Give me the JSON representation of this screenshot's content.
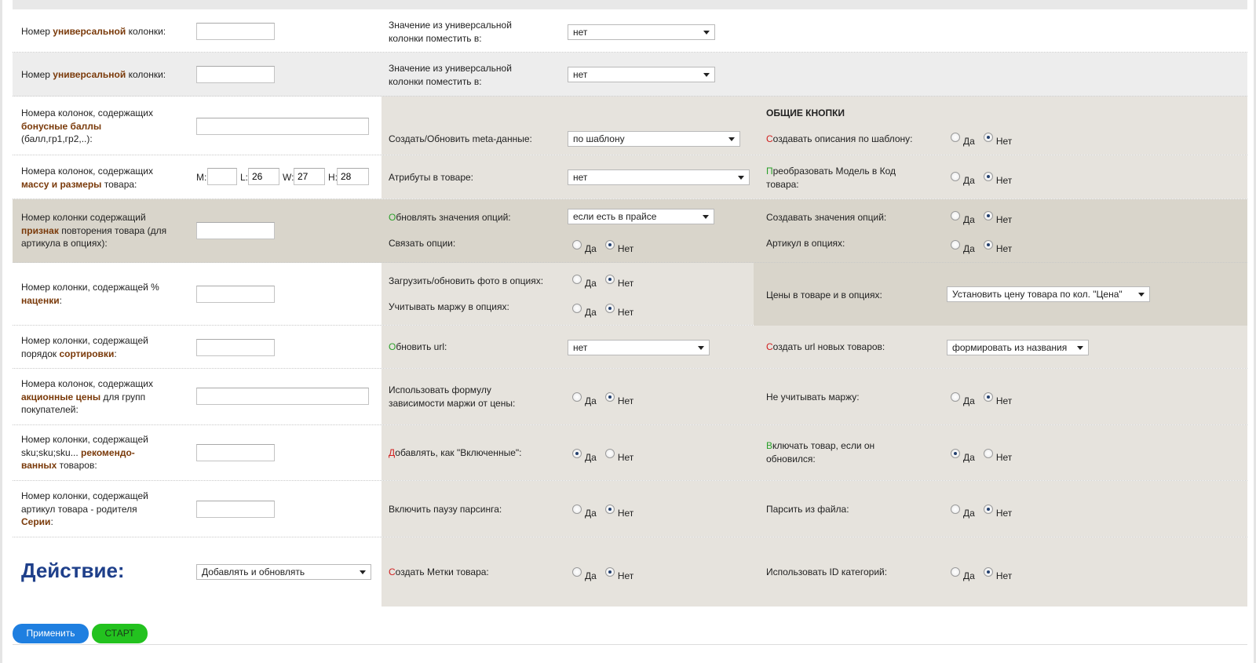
{
  "colors": {
    "brown_keyword": "#7a3a0a",
    "green_letter": "#2aa02a",
    "red_letter": "#d02020",
    "action_title": "#1e3f8a",
    "apply_button": "#1f7fe0",
    "start_button": "#23c21f"
  },
  "row1": {
    "label_pre": "Номер ",
    "label_kw": "универсальной",
    "label_post": " колонки:",
    "mid_label": "Значение из универсальной колонки поместить в:",
    "select_value": "нет"
  },
  "row2": {
    "label_pre": "Номер ",
    "label_kw": "универсальной",
    "label_post": " колонки:",
    "mid_label": "Значение из универсальной колонки поместить в:",
    "select_value": "нет"
  },
  "row3": {
    "label_pre": "Номера колонок, содержащих",
    "label_kw": "бонусные баллы",
    "label_post": "(балл,гр1,гр2,..):",
    "mid_label": "Создать/Обновить meta-данные:",
    "select_value": "по шаблону",
    "section_title": "ОБЩИЕ КНОПКИ",
    "right_first": "С",
    "right_rest": "оздавать описания по шаблону:",
    "radio_yes": "Да",
    "radio_no": "Нет"
  },
  "row4": {
    "label_pre": "Номера колонок, содержащих",
    "label_kw": "массу и размеры",
    "label_post": " товара:",
    "m_label": "M:",
    "m_value": "",
    "l_label": "L:",
    "l_value": "26",
    "w_label": "W:",
    "w_value": "27",
    "h_label": "H:",
    "h_value": "28",
    "mid_label": "Атрибуты в товаре:",
    "select_value": "нет",
    "right_first": "П",
    "right_rest": "реобразовать Модель в Код товара:",
    "radio_yes": "Да",
    "radio_no": "Нет"
  },
  "row5": {
    "label_pre": "Номер колонки содержащий",
    "label_kw": "признак",
    "label_post": " повторения товара (для артикула в опциях):",
    "mid1_first": "О",
    "mid1_rest": "бновлять значения опций:",
    "mid1_select": "если есть в прайсе",
    "mid2_label": "Связать опции:",
    "right1_label": "Создавать значения опций:",
    "right2_label": "Артикул в опциях:",
    "radio_yes": "Да",
    "radio_no": "Нет"
  },
  "row6": {
    "label_pre": "Номер колонки, содержащей %",
    "label_kw": "наценки",
    "label_post": ":",
    "mid1_label": "Загрузить/обновить фото в опциях:",
    "mid2_label": "Учитывать маржу в опциях:",
    "right_label": "Цены в товаре и в опциях:",
    "right_select": "Установить цену товара по кол. \"Цена\"",
    "radio_yes": "Да",
    "radio_no": "Нет"
  },
  "row7": {
    "label_pre": "Номер колонки, содержащей порядок ",
    "label_kw": "сортировки",
    "label_post": ":",
    "mid_first": "О",
    "mid_rest": "бновить url:",
    "select_value": "нет",
    "right_first": "С",
    "right_rest": "оздать url новых товаров:",
    "right_select": "формировать из названия"
  },
  "row8": {
    "label_pre": "Номера колонок, содержащих",
    "label_kw": "акционные цены",
    "label_post": " для групп покупателей:",
    "mid_label": "Использовать формулу зависимости маржи от цены:",
    "right_label": "Не учитывать маржу:",
    "radio_yes": "Да",
    "radio_no": "Нет"
  },
  "row9": {
    "label_pre": "Номер колонки, содержащей sku;sku;sku... ",
    "label_kw": "рекомендо-ванных",
    "label_post": " товаров:",
    "mid_first": "Д",
    "mid_rest": "обавлять, как \"Включенные\":",
    "right_first": "В",
    "right_rest": "ключать товар, если он обновился:",
    "radio_yes": "Да",
    "radio_no": "Нет"
  },
  "row10": {
    "label_pre": "Номер колонки, содержащей артикул товара - родителя",
    "label_kw": "Серии",
    "label_post": ":",
    "mid_label": "Включить паузу парсинга:",
    "right_label": "Парсить из файла:",
    "radio_yes": "Да",
    "radio_no": "Нет"
  },
  "row11": {
    "action_title": "Действие:",
    "action_select": "Добавлять и обновлять",
    "mid_first": "С",
    "mid_rest": "оздать Метки товара:",
    "right_label": "Использовать ID категорий:",
    "radio_yes": "Да",
    "radio_no": "Нет"
  },
  "buttons": {
    "apply": "Применить",
    "start": "СТАРТ"
  }
}
